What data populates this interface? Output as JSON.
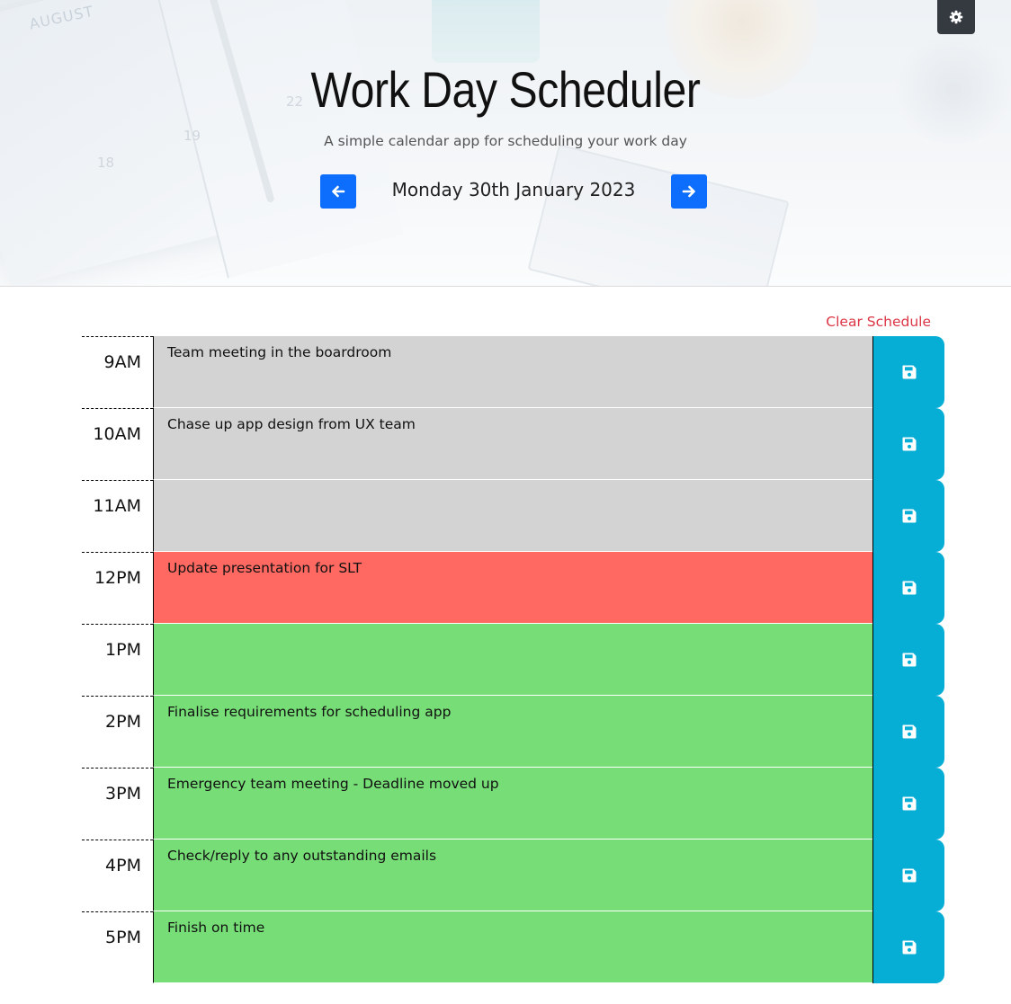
{
  "header": {
    "title": "Work Day Scheduler",
    "subtitle": "A simple calendar app for scheduling your work day",
    "date": "Monday 30th January 2023",
    "prev_icon": "arrow-left-icon",
    "next_icon": "arrow-right-icon",
    "settings_icon": "gear-icon",
    "background_deco": {
      "month": "AUGUST",
      "numbers": [
        "22",
        "19",
        "18"
      ]
    }
  },
  "schedule": {
    "clear_label": "Clear Schedule",
    "save_icon": "floppy-disk-icon",
    "rows": [
      {
        "hour": "9AM",
        "text": "Team meeting in the boardroom",
        "state": "past"
      },
      {
        "hour": "10AM",
        "text": "Chase up app design from UX team",
        "state": "past"
      },
      {
        "hour": "11AM",
        "text": "",
        "state": "past"
      },
      {
        "hour": "12PM",
        "text": "Update presentation for SLT",
        "state": "present"
      },
      {
        "hour": "1PM",
        "text": "",
        "state": "future"
      },
      {
        "hour": "2PM",
        "text": "Finalise requirements for scheduling app",
        "state": "future"
      },
      {
        "hour": "3PM",
        "text": "Emergency team meeting - Deadline moved up",
        "state": "future"
      },
      {
        "hour": "4PM",
        "text": "Check/reply to any outstanding emails",
        "state": "future"
      },
      {
        "hour": "5PM",
        "text": "Finish on time",
        "state": "future"
      }
    ]
  },
  "colors": {
    "past": "#d3d3d3",
    "present": "#ff6961",
    "future": "#77dd77",
    "save": "#06aed5",
    "nav": "#0d6efd",
    "clear": "#dc3545",
    "settings": "#343a40"
  }
}
